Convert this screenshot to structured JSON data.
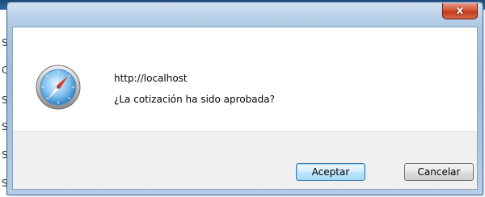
{
  "background": {
    "letters": [
      "S",
      "C",
      "S",
      "S",
      "S",
      "S"
    ]
  },
  "dialog": {
    "close_label": "x",
    "url": "http://localhost",
    "message": "¿La cotización ha sido aprobada?",
    "accept_label": "Aceptar",
    "cancel_label": "Cancelar",
    "icon": "safari-compass-icon"
  },
  "colors": {
    "close_button": "#c2391c",
    "accent_button_border": "#3c7fb1",
    "window_frame": "#a9c4e0"
  }
}
